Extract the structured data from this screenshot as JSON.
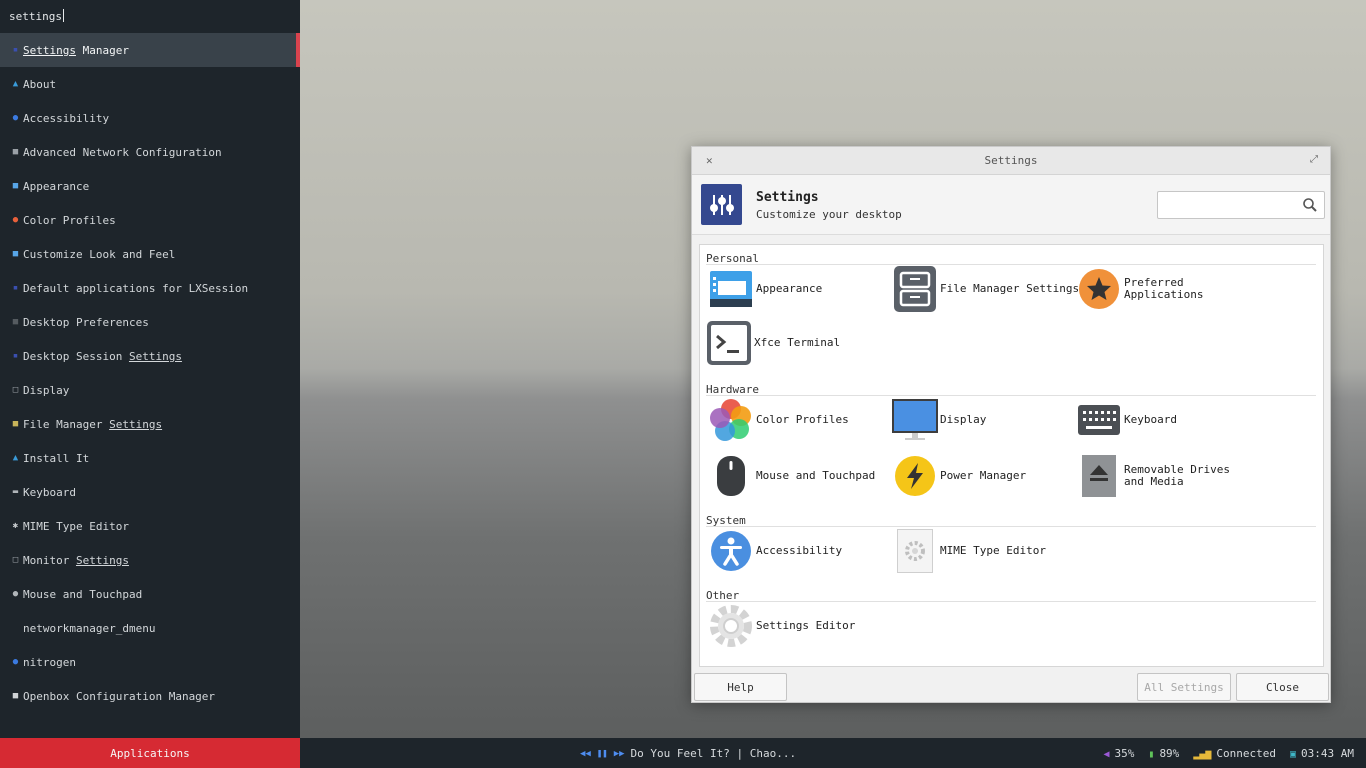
{
  "launcher": {
    "query": "settings",
    "items": [
      {
        "pre": "",
        "hl": "Settings",
        "post": " Manager",
        "icon": "settings-manager-icon",
        "color": "#3a4fb0",
        "glyph": "▪"
      },
      {
        "pre": "About",
        "hl": "",
        "post": "",
        "icon": "arch-logo-icon",
        "color": "#3a9bd9",
        "glyph": "▲"
      },
      {
        "pre": "Accessibility",
        "hl": "",
        "post": "",
        "icon": "accessibility-icon",
        "color": "#3b7ae0",
        "glyph": "●"
      },
      {
        "pre": "Advanced Network Configuration",
        "hl": "",
        "post": "",
        "icon": "network-icon",
        "color": "#9aa0a6",
        "glyph": "■"
      },
      {
        "pre": "Appearance",
        "hl": "",
        "post": "",
        "icon": "appearance-icon",
        "color": "#58a6e8",
        "glyph": "■"
      },
      {
        "pre": "Color Profiles",
        "hl": "",
        "post": "",
        "icon": "color-profiles-icon",
        "color": "#e8603b",
        "glyph": "●"
      },
      {
        "pre": "Customize Look and Feel",
        "hl": "",
        "post": "",
        "icon": "look-feel-icon",
        "color": "#58a6e8",
        "glyph": "■"
      },
      {
        "pre": "Default applications for LXSession",
        "hl": "",
        "post": "",
        "icon": "lxsession-icon",
        "color": "#3a4fb0",
        "glyph": "▪"
      },
      {
        "pre": "Desktop Preferences",
        "hl": "",
        "post": "",
        "icon": "desktop-prefs-icon",
        "color": "#555b60",
        "glyph": "■"
      },
      {
        "pre": "Desktop Session ",
        "hl": "Settings",
        "post": "",
        "icon": "desktop-session-icon",
        "color": "#3a4fb0",
        "glyph": "▪"
      },
      {
        "pre": "Display",
        "hl": "",
        "post": "",
        "icon": "display-icon",
        "color": "#9aa0a6",
        "glyph": "□"
      },
      {
        "pre": "File Manager ",
        "hl": "Settings",
        "post": "",
        "icon": "file-manager-icon",
        "color": "#c8b45a",
        "glyph": "■"
      },
      {
        "pre": "Install It",
        "hl": "",
        "post": "",
        "icon": "install-icon",
        "color": "#3a9bd9",
        "glyph": "▲"
      },
      {
        "pre": "Keyboard",
        "hl": "",
        "post": "",
        "icon": "keyboard-icon",
        "color": "#b0b5b9",
        "glyph": "▬"
      },
      {
        "pre": "MIME Type Editor",
        "hl": "",
        "post": "",
        "icon": "mime-icon",
        "color": "#c9cdd0",
        "glyph": "✱"
      },
      {
        "pre": "Monitor ",
        "hl": "Settings",
        "post": "",
        "icon": "monitor-icon",
        "color": "#9aa0a6",
        "glyph": "□"
      },
      {
        "pre": "Mouse and Touchpad",
        "hl": "",
        "post": "",
        "icon": "mouse-icon",
        "color": "#b0b5b9",
        "glyph": "●"
      },
      {
        "pre": "networkmanager_dmenu",
        "hl": "",
        "post": "",
        "icon": "",
        "color": "#1e252b",
        "glyph": ""
      },
      {
        "pre": "nitrogen",
        "hl": "",
        "post": "",
        "icon": "nitrogen-icon",
        "color": "#3b7ae0",
        "glyph": "●"
      },
      {
        "pre": "Openbox Configuration Manager",
        "hl": "",
        "post": "",
        "icon": "openbox-icon",
        "color": "#d0d3d6",
        "glyph": "■"
      }
    ],
    "apps_label": "Applications"
  },
  "panel": {
    "track": "Do You Feel It? | Chao...",
    "volume": "35%",
    "battery": "89%",
    "network": "Connected",
    "clock": "03:43 AM"
  },
  "window": {
    "title": "Settings",
    "header_title": "Settings",
    "header_subtitle": "Customize your desktop",
    "sections": {
      "personal": "Personal",
      "hardware": "Hardware",
      "system": "System",
      "other": "Other"
    },
    "items": {
      "appearance": "Appearance",
      "file_manager": "File Manager Settings",
      "preferred_apps": "Preferred Applications",
      "terminal": "Xfce Terminal",
      "color_profiles": "Color Profiles",
      "display": "Display",
      "keyboard": "Keyboard",
      "mouse": "Mouse and Touchpad",
      "power": "Power Manager",
      "removable": "Removable Drives and Media",
      "accessibility": "Accessibility",
      "mime": "MIME Type Editor",
      "settings_editor": "Settings Editor"
    },
    "buttons": {
      "help": "Help",
      "all_settings": "All Settings",
      "close": "Close"
    }
  }
}
